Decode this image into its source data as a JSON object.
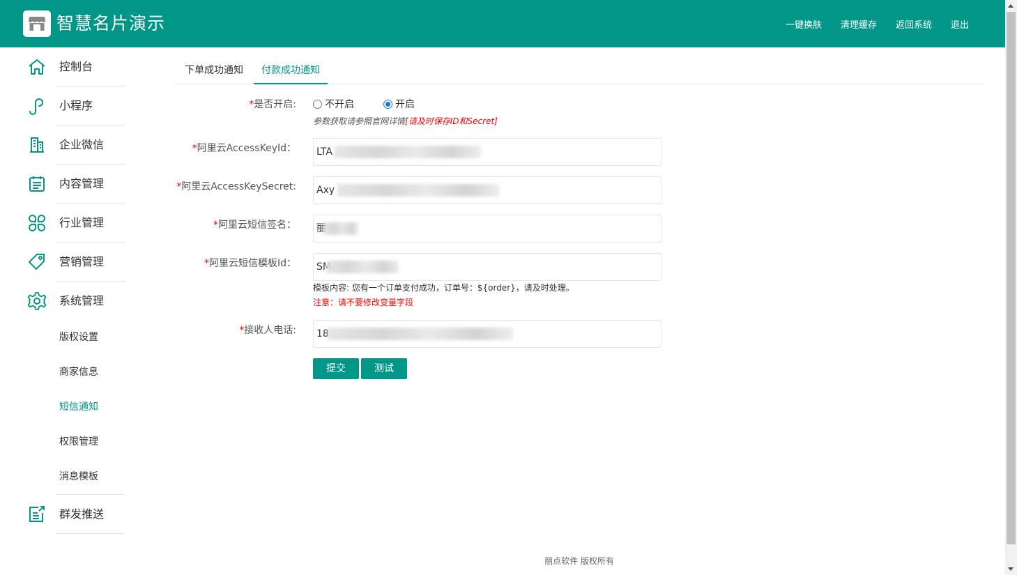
{
  "header": {
    "title": "智慧名片演示",
    "links": [
      "一键换肤",
      "清理缓存",
      "返回系统",
      "退出"
    ]
  },
  "sidebar": {
    "items": [
      {
        "label": "控制台",
        "icon": "home-icon"
      },
      {
        "label": "小程序",
        "icon": "mini-program-icon"
      },
      {
        "label": "企业微信",
        "icon": "building-icon"
      },
      {
        "label": "内容管理",
        "icon": "clipboard-icon"
      },
      {
        "label": "行业管理",
        "icon": "clover-icon"
      },
      {
        "label": "营销管理",
        "icon": "tag-icon"
      },
      {
        "label": "系统管理",
        "icon": "gear-icon"
      },
      {
        "label": "群发推送",
        "icon": "send-list-icon"
      }
    ],
    "sub_items": [
      "版权设置",
      "商家信息",
      "短信通知",
      "权限管理",
      "消息模板"
    ],
    "active_sub": "短信通知"
  },
  "tabs": [
    "下单成功通知",
    "付款成功通知"
  ],
  "active_tab": "付款成功通知",
  "form": {
    "enable": {
      "label": "是否开启:",
      "options": [
        "不开启",
        "开启"
      ],
      "selected": "开启",
      "hint_prefix": "参数获取请参照官网详情",
      "hint_red": "[请及时保存ID和Secret]"
    },
    "access_key_id": {
      "label": "阿里云AccessKeyId：",
      "value": "LTA"
    },
    "access_key_secret": {
      "label": "阿里云AccessKeySecret:",
      "value": "Axy"
    },
    "sign_name": {
      "label": "阿里云短信签名：",
      "value": "丽"
    },
    "template_id": {
      "label": "阿里云短信模板Id：",
      "value": "SM",
      "template_content": "模板内容: 您有一个订单支付成功，订单号：${order}，请及时处理。",
      "note": "注意：请不要修改变量字段"
    },
    "receiver_phone": {
      "label": "接收人电话:",
      "value": "18"
    },
    "required_mark": "*"
  },
  "buttons": {
    "submit": "提交",
    "test": "测试"
  },
  "footer": {
    "text": "丽点软件 版权所有"
  },
  "colors": {
    "brand": "#009688",
    "required": "#ff0000"
  }
}
